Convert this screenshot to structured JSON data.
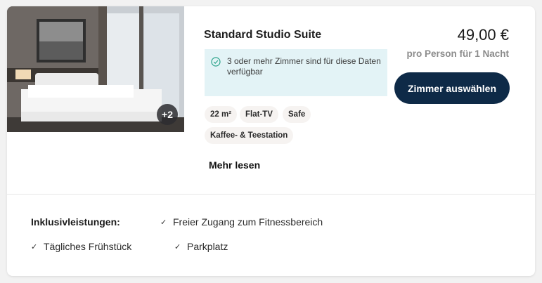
{
  "room": {
    "title": "Standard Studio Suite",
    "photo_more_count": "+2",
    "availability": "3 oder mehr Zimmer sind für diese Daten verfügbar",
    "features": [
      "22 m²",
      "Flat-TV",
      "Safe",
      "Kaffee- & Teestation"
    ],
    "read_more_label": "Mehr lesen"
  },
  "pricing": {
    "price": "49,00 €",
    "price_basis": "pro Person für 1 Nacht",
    "select_label": "Zimmer auswählen"
  },
  "inclusions": {
    "label": "Inklusivleistungen:",
    "items": [
      "Freier Zugang zum Fitnessbereich",
      "Tägliches Frühstück",
      "Parkplatz"
    ]
  },
  "colors": {
    "button_bg": "#0e2a47",
    "availability_bg": "#e3f3f6",
    "availability_icon": "#2aa38a"
  },
  "icons": {
    "availability": "check-circle-icon",
    "inclusion": "checkmark-icon"
  }
}
